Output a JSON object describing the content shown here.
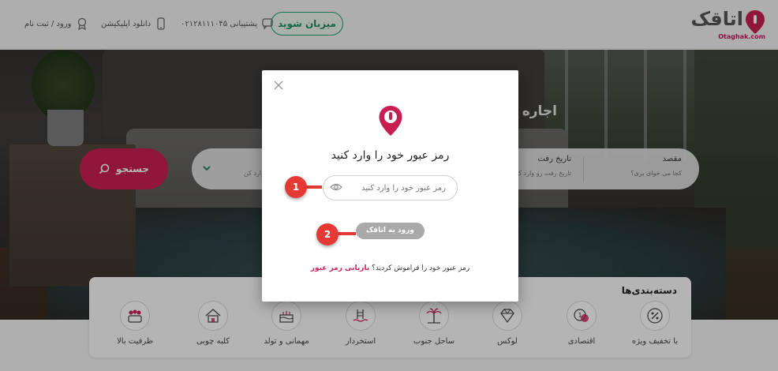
{
  "header": {
    "logo_text": "اتاقک",
    "logo_sub": "Otaghak.com",
    "host_button": "میزبان شوید",
    "support_label": "پشتیبانی ۰۲۱۲۸۱۱۱۰۴۵",
    "download_label": "دانلود اپلیکیشن",
    "login_label": "ورود / ثبت نام"
  },
  "hero": {
    "title": "اجاره آ... ان زیبا",
    "search": {
      "destination_label": "مقصد",
      "destination_sub": "کجا می خوای بری؟",
      "checkin_label": "تاریخ رفت",
      "checkin_sub": "تاریخ رفت رو وارد کن",
      "guests_sub": "وارد کن",
      "search_button": "جستجو"
    }
  },
  "categories": {
    "title": "دسته‌بندی‌ها",
    "items": [
      {
        "label": "با تخفیف ویژه",
        "icon": "percent-icon"
      },
      {
        "label": "اقتصادی",
        "icon": "coins-icon"
      },
      {
        "label": "لوکس",
        "icon": "diamond-icon"
      },
      {
        "label": "ساحل جنوب",
        "icon": "palm-icon"
      },
      {
        "label": "استخردار",
        "icon": "pool-icon"
      },
      {
        "label": "مهمانی و تولد",
        "icon": "cake-icon"
      },
      {
        "label": "کلبه چوبی",
        "icon": "cabin-icon"
      },
      {
        "label": "ظرفیت بالا",
        "icon": "group-icon"
      }
    ]
  },
  "modal": {
    "title": "رمز عبور خود را وارد کنید",
    "password_placeholder": "رمز عبور خود را وارد کنید",
    "login_button": "ورود به اتاقک",
    "forgot_text": "رمز عبور خود را فراموش کردید؟",
    "forgot_link": "بازیابی رمز عبور"
  },
  "annotations": {
    "step1": "1",
    "step2": "2"
  },
  "colors": {
    "brand": "#c81f52",
    "host_green": "#1f8a62",
    "annotation_red": "#e53935"
  }
}
